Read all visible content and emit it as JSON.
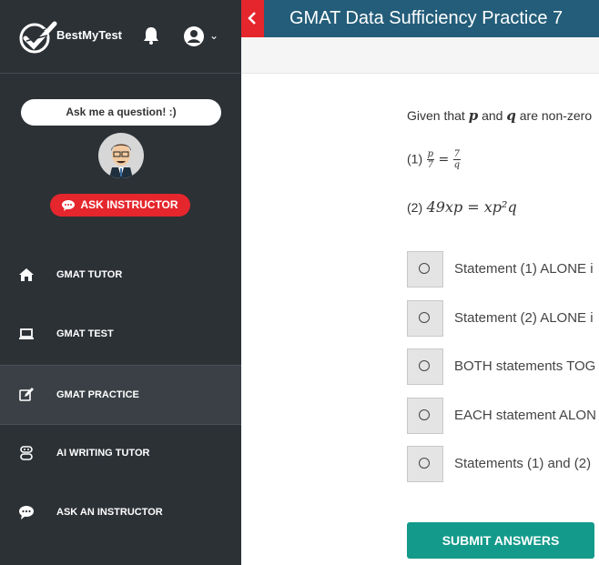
{
  "sidebar": {
    "brand": "BestMyTest",
    "bubble": "Ask me a question! :)",
    "ask_button": "ASK INSTRUCTOR",
    "nav": [
      {
        "label": "GMAT TUTOR",
        "icon": "home-icon"
      },
      {
        "label": "GMAT TEST",
        "icon": "laptop-icon"
      },
      {
        "label": "GMAT PRACTICE",
        "icon": "edit-icon",
        "active": true
      },
      {
        "label": "AI WRITING TUTOR",
        "icon": "robot-icon"
      },
      {
        "label": "ASK AN INSTRUCTOR",
        "icon": "chat-icon"
      }
    ]
  },
  "header": {
    "title": "GMAT Data Sufficiency Practice 7"
  },
  "question": {
    "prefix": "Given that",
    "var_p": "p",
    "and": "and",
    "var_q": "q",
    "suffix": "are non-zero"
  },
  "statements": {
    "one_label": "(1)",
    "one_lhs_num": "p",
    "one_lhs_den": "7",
    "one_eq": "=",
    "one_rhs_num": "7",
    "one_rhs_den": "q",
    "two_label": "(2)",
    "two_expr": "49xp = xp²q"
  },
  "options": [
    "Statement (1) ALONE i",
    "Statement (2) ALONE i",
    "BOTH statements TOG",
    "EACH statement ALON",
    "Statements (1) and (2)"
  ],
  "submit": "SUBMIT ANSWERS",
  "colors": {
    "sidebar": "#2c3136",
    "header": "#235d79",
    "accent_red": "#e5262d",
    "submit": "#139a8b"
  }
}
